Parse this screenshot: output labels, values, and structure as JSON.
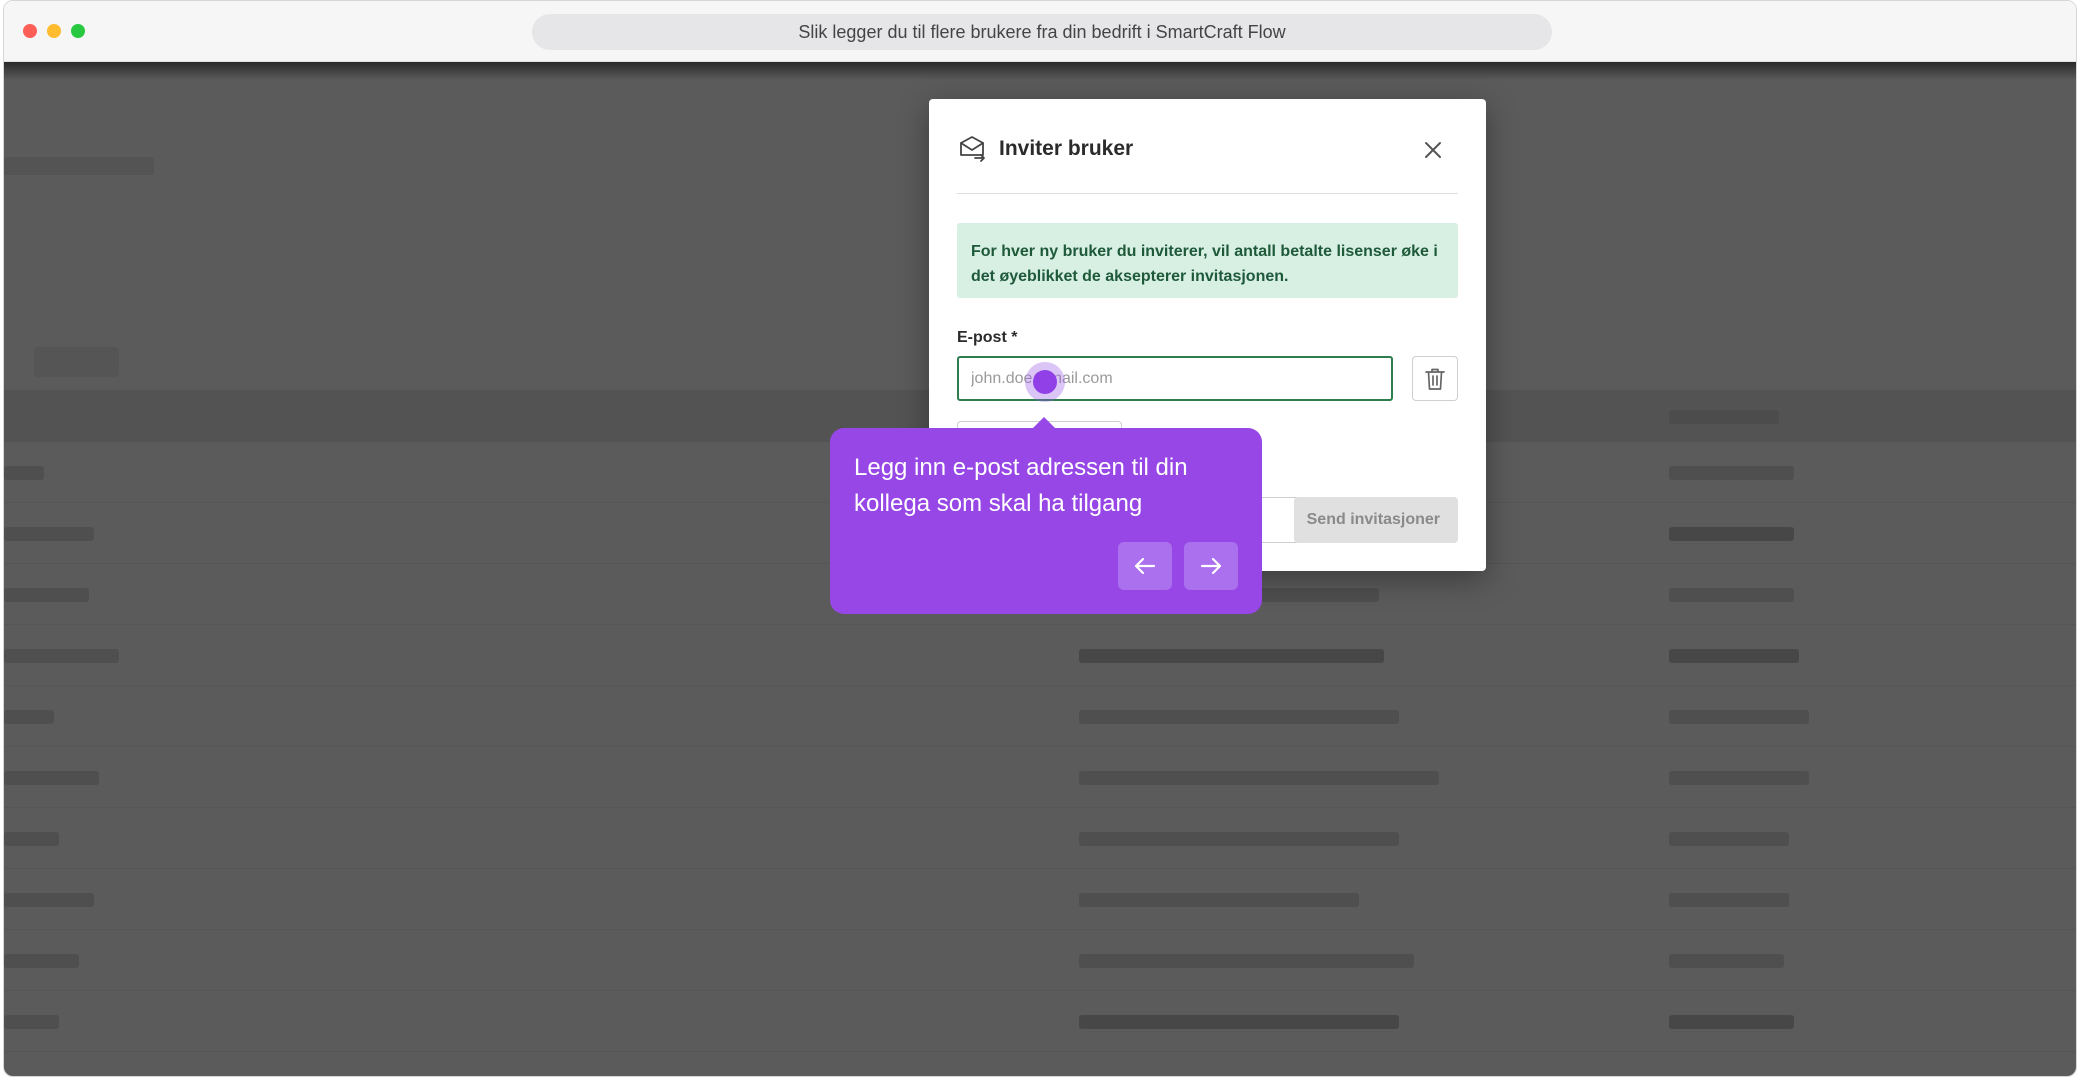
{
  "window": {
    "title": "Slik legger du til flere brukere fra din bedrift i SmartCraft Flow"
  },
  "modal": {
    "title": "Inviter bruker",
    "info_text": "For hver ny bruker du inviterer, vil antall betalte lisenser øke i det øyeblikket de aksepterer invitasjonen.",
    "email_label": "E-post *",
    "email_placeholder": "john.doe@mail.com",
    "email_value": "",
    "send_label": "Send invitasjoner",
    "icons": {
      "header": "mail-icon",
      "close": "close-icon",
      "delete": "trash-icon"
    }
  },
  "tooltip": {
    "text": "Legg inn e-post adressen til din kollega som skal ha tilgang",
    "prev_icon": "arrow-left-icon",
    "next_icon": "arrow-right-icon"
  },
  "colors": {
    "overlay": "#5b5b5b",
    "accent_green": "#2e7d4f",
    "info_bg": "#d8efe3",
    "tooltip_bg": "#9747e6"
  }
}
